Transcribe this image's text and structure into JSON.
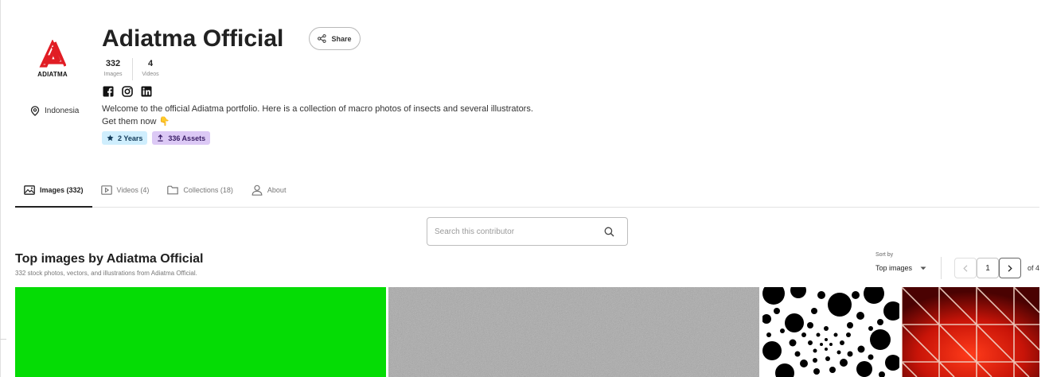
{
  "brand": {
    "logo_text": "ADIATMA",
    "accent": "#e11d24"
  },
  "profile": {
    "name": "Adiatma Official",
    "share_label": "Share",
    "location": "Indonesia",
    "stats": [
      {
        "value": "332",
        "label": "Images"
      },
      {
        "value": "4",
        "label": "Videos"
      }
    ],
    "socials": [
      "facebook-icon",
      "instagram-icon",
      "linkedin-icon"
    ],
    "bio_line1": "Welcome to the official Adiatma portfolio. Here is a collection of macro photos of insects and several illustrators.",
    "bio_line2": "Get them now 👇",
    "badges": {
      "years": {
        "label": "2 Years",
        "icon": "star-icon",
        "color": "#cfeefd"
      },
      "assets": {
        "label": "336 Assets",
        "icon": "upload-icon",
        "color": "#dcc9f5"
      }
    }
  },
  "tabs": [
    {
      "label": "Images (332)",
      "icon": "image-icon",
      "active": true
    },
    {
      "label": "Videos (4)",
      "icon": "video-icon",
      "active": false
    },
    {
      "label": "Collections (18)",
      "icon": "folder-icon",
      "active": false
    },
    {
      "label": "About",
      "icon": "person-icon",
      "active": false
    }
  ],
  "search": {
    "placeholder": "Search this contributor",
    "value": ""
  },
  "section": {
    "title": "Top images by Adiatma Official",
    "subtitle": "332 stock photos, vectors, and illustrations from Adiatma Official."
  },
  "sort": {
    "label": "Sort by",
    "value": "Top images"
  },
  "pagination": {
    "prev": "‹",
    "current": "1",
    "next": "›",
    "of_label": "of 4"
  },
  "images": [
    {
      "desc": "green-screen",
      "color": "#05dc05"
    },
    {
      "desc": "gray-noise",
      "color": "#a8a8a8"
    },
    {
      "desc": "black-dots",
      "color": "#000000"
    },
    {
      "desc": "red-triangles",
      "color": "#7a0505"
    }
  ]
}
